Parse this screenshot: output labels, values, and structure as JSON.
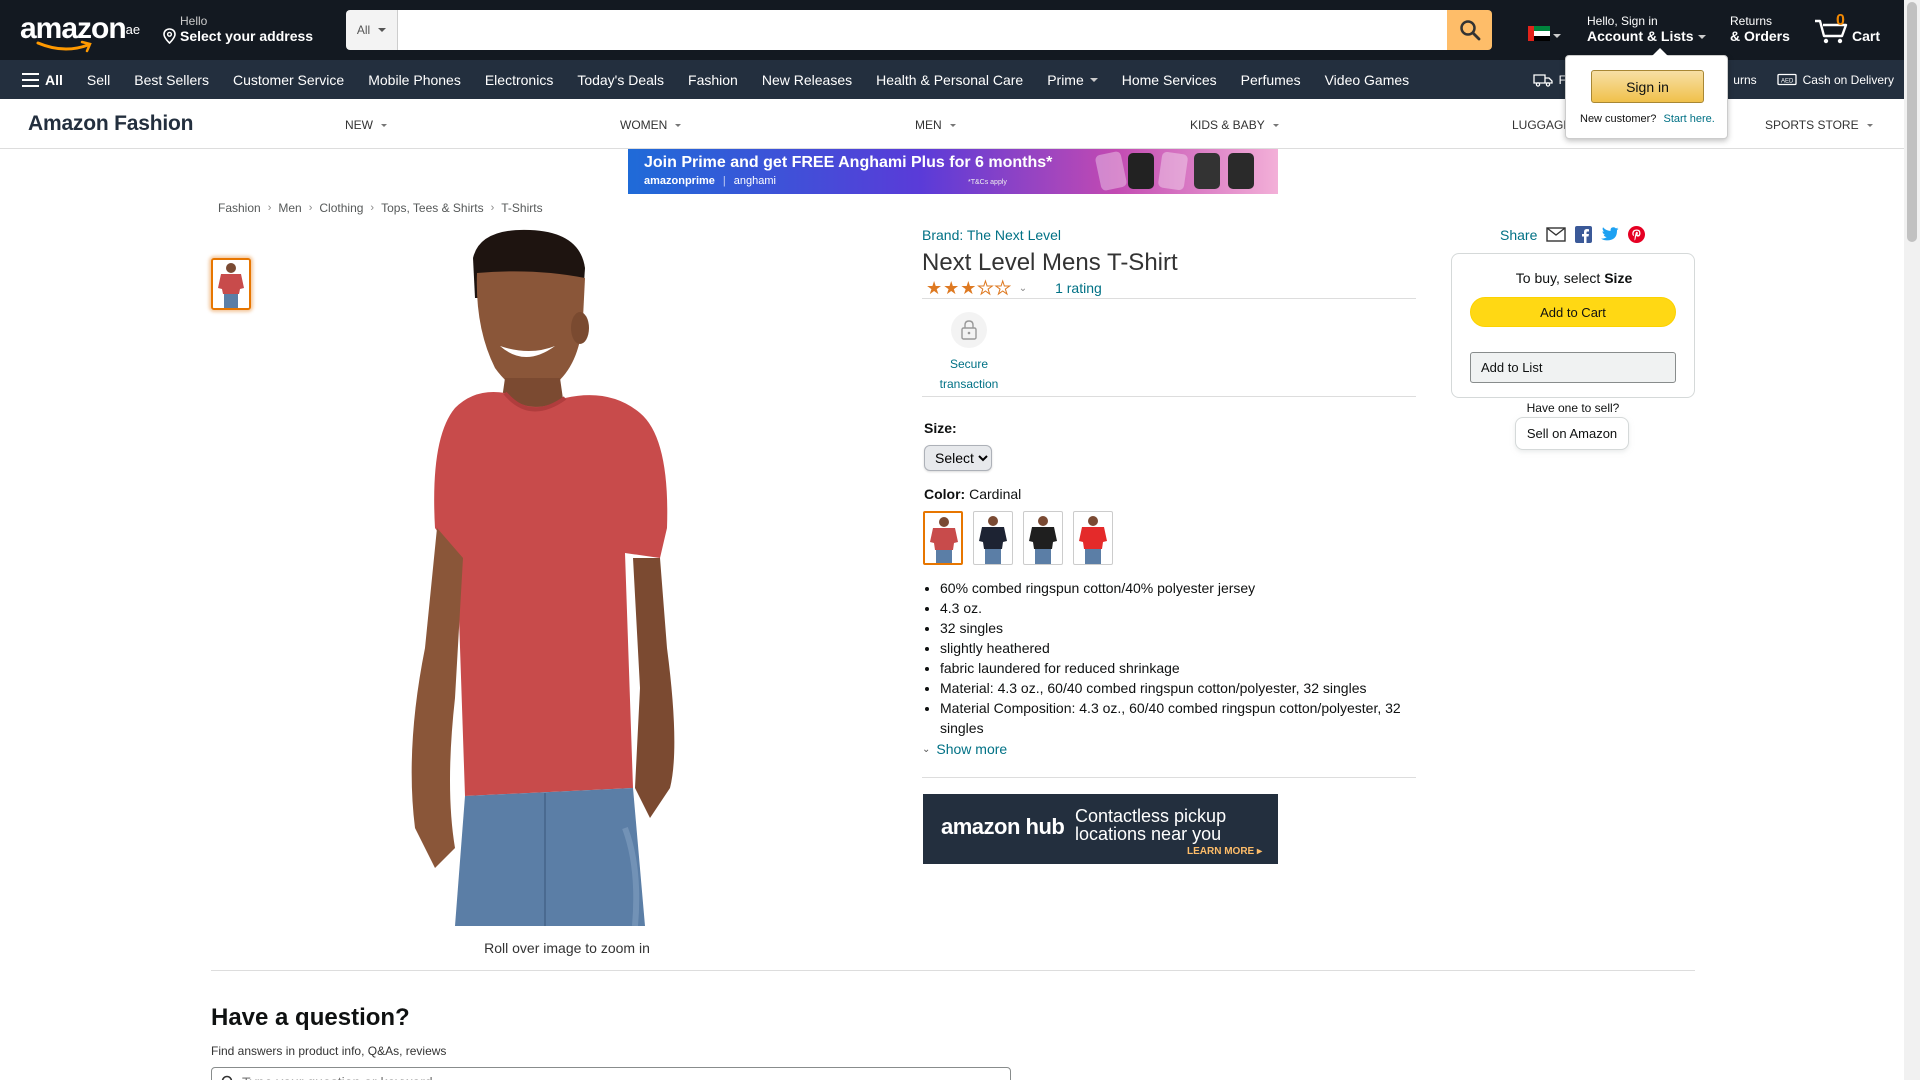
{
  "header": {
    "logo": "amazon",
    "logo_tld": ".ae",
    "address_line1": "Hello",
    "address_line2": "Select your address",
    "search_category": "All",
    "search_placeholder": "",
    "account_line1": "Hello, Sign in",
    "account_line2": "Account & Lists",
    "orders_line1": "Returns",
    "orders_line2": "& Orders",
    "cart_count": "0",
    "cart_label": "Cart"
  },
  "subnav": {
    "all_label": "All",
    "items": [
      "Sell",
      "Best Sellers",
      "Customer Service",
      "Mobile Phones",
      "Electronics",
      "Today's Deals",
      "Fashion",
      "New Releases",
      "Health & Personal Care",
      "Prime",
      "Home Services",
      "Perfumes",
      "Video Games"
    ],
    "right_items": [
      "Fast &",
      "urns",
      "Cash on Delivery"
    ]
  },
  "fashion_bar": {
    "title": "Amazon Fashion",
    "categories": [
      "NEW",
      "WOMEN",
      "MEN",
      "KIDS & BABY",
      "LUGGAGE",
      "SPORTS STORE"
    ]
  },
  "banner": {
    "headline": "Join Prime and get FREE Anghami Plus for 6 months*",
    "brand1": "amazonprime",
    "brand2": "anghami",
    "tc": "*T&Cs apply"
  },
  "breadcrumb": [
    "Fashion",
    "Men",
    "Clothing",
    "Tops, Tees & Shirts",
    "T-Shirts"
  ],
  "product": {
    "brand_link": "Brand: The Next Level",
    "title": "Next Level Mens T-Shirt",
    "rating_stars": 3,
    "rating_count": "1 rating",
    "secure_label": "Secure transaction",
    "zoom_hint": "Roll over image to zoom in",
    "size_label": "Size:",
    "size_select": "Select",
    "color_label": "Color:",
    "color_value": "Cardinal",
    "swatch_colors": [
      "#c84b4b",
      "#1d2333",
      "#1f1f1f",
      "#e42a2a"
    ],
    "bullets": [
      "60% combed ringspun cotton/40% polyester jersey",
      "4.3 oz.",
      "32 singles",
      "slightly heathered",
      "fabric laundered for reduced shrinkage",
      "Material: 4.3 oz., 60/40 combed ringspun cotton/polyester, 32 singles",
      "Material Composition: 4.3 oz., 60/40 combed ringspun cotton/polyester, 32 singles"
    ],
    "show_more": "Show more"
  },
  "hub_ad": {
    "logo": "amazon hub",
    "line1": "Contactless pickup",
    "line2": "locations near you",
    "cta": "LEARN MORE ▸"
  },
  "share": {
    "label": "Share"
  },
  "buybox": {
    "title_prefix": "To buy, select",
    "title_bold": "Size",
    "add_to_cart": "Add to Cart",
    "add_to_list": "Add to List",
    "sell_question": "Have one to sell?",
    "sell_button": "Sell on Amazon"
  },
  "flyout": {
    "signin": "Sign in",
    "new_customer": "New customer?",
    "start_here": "Start here."
  },
  "question": {
    "title": "Have a question?",
    "subtitle": "Find answers in product info, Q&As, reviews",
    "placeholder": "Type your question or keyword"
  },
  "colors": {
    "nav_dark": "#131921",
    "nav_sub": "#232f3e",
    "search_button": "#febd69",
    "add_to_cart": "#ffd814",
    "link": "#007185",
    "star": "#de7921"
  }
}
